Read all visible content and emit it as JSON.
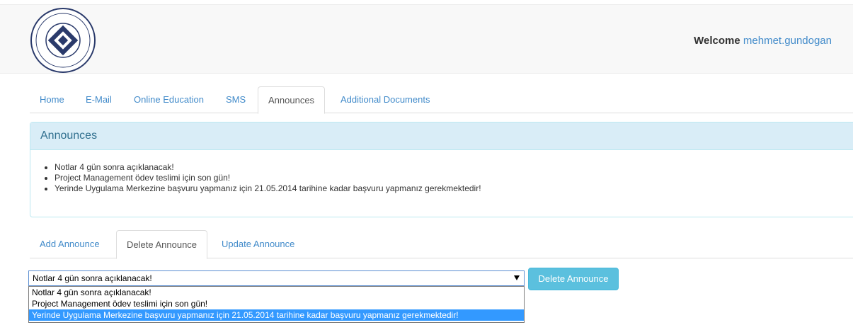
{
  "header": {
    "welcome_label": "Welcome",
    "username": "mehmet.gundogan"
  },
  "nav_tabs": [
    {
      "label": "Home",
      "active": false
    },
    {
      "label": "E-Mail",
      "active": false
    },
    {
      "label": "Online Education",
      "active": false
    },
    {
      "label": "SMS",
      "active": false
    },
    {
      "label": "Announces",
      "active": true
    },
    {
      "label": "Additional Documents",
      "active": false
    }
  ],
  "announces_panel": {
    "title": "Announces",
    "items": [
      "Notlar 4 gün sonra açıklanacak!",
      "Project Management ödev teslimi için son gün!",
      "Yerinde Uygulama Merkezine başvuru yapmanız için 21.05.2014 tarihine kadar başvuru yapmanız gerekmektedir!"
    ]
  },
  "action_tabs": [
    {
      "label": "Add Announce",
      "active": false
    },
    {
      "label": "Delete Announce",
      "active": true
    },
    {
      "label": "Update Announce",
      "active": false
    }
  ],
  "delete_form": {
    "selected_value": "Notlar 4 gün sonra açıklanacak!",
    "options": [
      "Notlar 4 gün sonra açıklanacak!",
      "Project Management ödev teslimi için son gün!",
      "Yerinde Uygulama Merkezine başvuru yapmanız için 21.05.2014 tarihine kadar başvuru yapmanız gerekmektedir!"
    ],
    "highlighted_option_index": 2,
    "button_label": "Delete Announce"
  },
  "colors": {
    "link": "#428bca",
    "panel_heading_bg": "#d9edf7",
    "panel_heading_text": "#31708f",
    "button_bg": "#5bc0de",
    "option_highlight": "#3399ff"
  }
}
